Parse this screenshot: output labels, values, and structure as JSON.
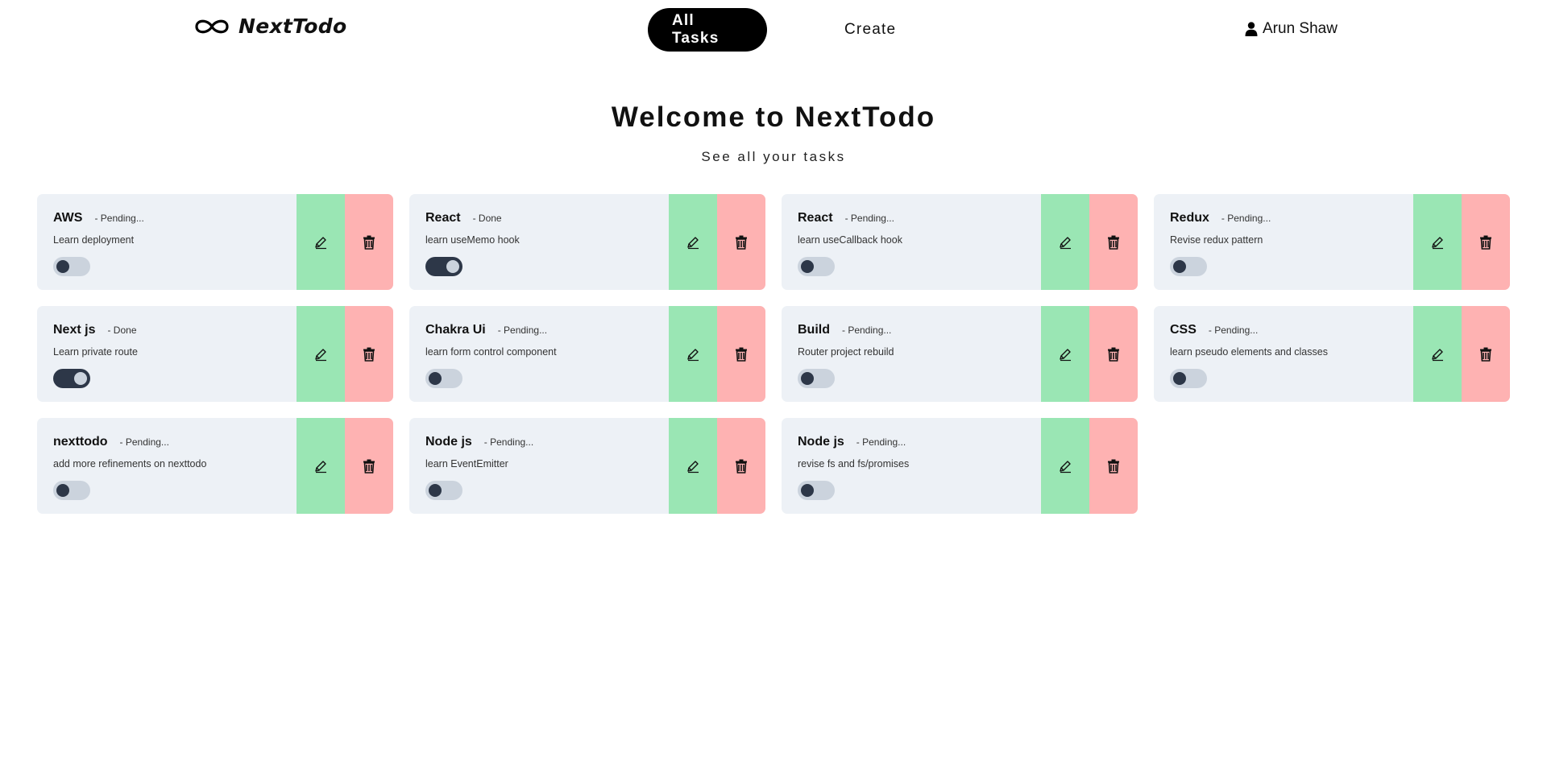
{
  "brand": {
    "name": "NextTodo",
    "logo_icon": "infinity-icon"
  },
  "nav": {
    "all_tasks": "All Tasks",
    "create": "Create"
  },
  "user": {
    "name": "Arun Shaw",
    "icon": "user-icon"
  },
  "hero": {
    "title": "Welcome to NextTodo",
    "subtitle": "See all your tasks"
  },
  "colors": {
    "card_bg": "#edf1f6",
    "edit_bg": "#9ae6b4",
    "delete_bg": "#feb2b2",
    "toggle_on": "#2d3748",
    "toggle_off": "#cbd3dd"
  },
  "tasks": [
    {
      "title": "AWS",
      "status": "- Pending...",
      "description": "Learn deployment",
      "done": false
    },
    {
      "title": "React",
      "status": "- Done",
      "description": "learn useMemo hook",
      "done": true
    },
    {
      "title": "React",
      "status": "- Pending...",
      "description": "learn useCallback hook",
      "done": false
    },
    {
      "title": "Redux",
      "status": "- Pending...",
      "description": "Revise redux pattern",
      "done": false
    },
    {
      "title": "Next js",
      "status": "- Done",
      "description": "Learn private route",
      "done": true
    },
    {
      "title": "Chakra Ui",
      "status": "- Pending...",
      "description": "learn form control component",
      "done": false
    },
    {
      "title": "Build",
      "status": "- Pending...",
      "description": "Router project rebuild",
      "done": false
    },
    {
      "title": "CSS",
      "status": "- Pending...",
      "description": "learn pseudo elements and classes",
      "done": false
    },
    {
      "title": "nexttodo",
      "status": "- Pending...",
      "description": "add more refinements on nexttodo",
      "done": false
    },
    {
      "title": "Node js",
      "status": "- Pending...",
      "description": "learn EventEmitter",
      "done": false
    },
    {
      "title": "Node js",
      "status": "- Pending...",
      "description": "revise fs and fs/promises",
      "done": false
    }
  ]
}
